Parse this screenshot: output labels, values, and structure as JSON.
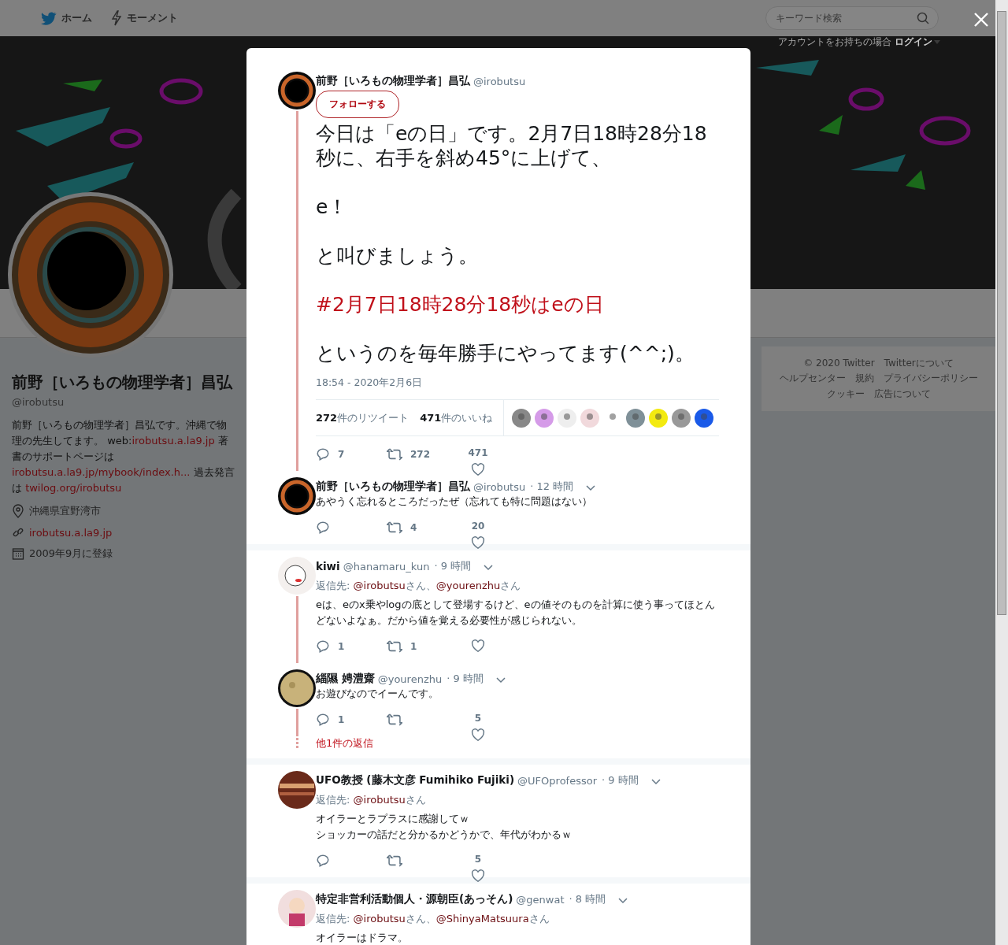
{
  "topnav": {
    "items": [
      {
        "kind": "bird",
        "label": "ホーム"
      },
      {
        "kind": "bolt",
        "label": "モーメント"
      }
    ],
    "search": {
      "placeholder": "キーワード検索"
    },
    "login_prompt": "アカウントをお持ちの場合",
    "login": "ログイン"
  },
  "profile": {
    "name": "前野［いろもの物理学者］昌弘",
    "handle": "@irobutsu",
    "bio": [
      {
        "kind": "text",
        "text": "前野［いろもの物理学者］昌弘です。沖縄で物理の先生してます。 web:"
      },
      {
        "kind": "link",
        "text": "irobutsu.a.la9.jp"
      },
      {
        "kind": "text",
        "text": " 著書のサポートページは "
      },
      {
        "kind": "link",
        "text": "irobutsu.a.la9.jp/mybook/index.h..."
      },
      {
        "kind": "text",
        "text": " 過去発言は "
      },
      {
        "kind": "link",
        "text": "twilog.org/irobutsu"
      }
    ],
    "meta": [
      {
        "kind": "location",
        "text": "沖縄県宜野湾市"
      },
      {
        "kind": "website",
        "text": "irobutsu.a.la9.jp"
      },
      {
        "kind": "joined",
        "text": "2009年9月に登録"
      }
    ]
  },
  "footer_links": [
    "© 2020 Twitter",
    "Twitterについて",
    "ヘルプセンター",
    "規約",
    "プライバシーポリシー",
    "クッキー",
    "広告について"
  ],
  "modal": {
    "tweet": {
      "name": "前野［いろもの物理学者］昌弘",
      "handle": "@irobutsu",
      "follow": "フォローする",
      "paragraphs": [
        {
          "kind": "text",
          "text": "今日は「eの日」です。2月7日18時28分18秒に、右手を斜め45°に上げて、"
        },
        {
          "kind": "text",
          "text": "e！"
        },
        {
          "kind": "text",
          "text": "と叫びましょう。"
        },
        {
          "kind": "hashtag",
          "text": "#2月7日18時28分18秒はeの日"
        },
        {
          "kind": "text",
          "text": "というのを毎年勝手にやってます(^^;)。"
        }
      ],
      "timestamp": "18:54 - 2020年2月6日",
      "retweet_stat": "**272**件のリツイート",
      "like_stat": "**471**件のいいね",
      "replies": "7",
      "retweets": "272",
      "likes": "471"
    },
    "groups": [
      [
        {
          "kind": "swirl",
          "name": "前野［いろもの物理学者］昌弘",
          "handle": "@irobutsu",
          "time": "· 12 時間",
          "lines": [
            "あやうく忘れるところだったぜ（忘れても特に問題はない）"
          ],
          "actions": true,
          "retweets": "4",
          "likes": "20",
          "thread": false
        }
      ],
      [
        {
          "kind": "sketch",
          "name": "kiwi",
          "handle": "@hanamaru_kun",
          "time": "· 9 時間",
          "reply_to": [
            {
              "kind": "text",
              "text": "返信先: "
            },
            {
              "kind": "link",
              "text": "@irobutsu"
            },
            {
              "kind": "text",
              "text": "さん、"
            },
            {
              "kind": "link",
              "text": "@yourenzhu"
            },
            {
              "kind": "text",
              "text": "さん"
            }
          ],
          "lines": [
            "eは、eのx乗やlogの底として登場するけど、eの値そのものを計算に使う事ってほとんどないよなぁ。だから値を覚える必要性が感じられない。"
          ],
          "actions": true,
          "replies": "1",
          "retweets": "1",
          "thread": true
        },
        {
          "kind": "moon",
          "name": "緇隰 娉澧齋",
          "handle": "@yourenzhu",
          "time": "· 9 時間",
          "lines": [
            "お遊びなのでイーんです。"
          ],
          "actions": true,
          "replies": "1",
          "likes": "5",
          "thread": true,
          "more": "他1件の返信"
        }
      ],
      [
        {
          "kind": "planet",
          "name": "UFO教授 (藤木文彦 Fumihiko Fujiki)",
          "handle": "@UFOprofessor",
          "time": "· 9 時間",
          "reply_to": [
            {
              "kind": "text",
              "text": "返信先: "
            },
            {
              "kind": "link",
              "text": "@irobutsu"
            },
            {
              "kind": "text",
              "text": "さん"
            }
          ],
          "lines": [
            "オイラーとラプラスに感謝してｗ",
            "ショッカーの話だと分かるかどうかで、年代がわかるｗ"
          ],
          "actions": true,
          "likes": "5",
          "thread": false
        }
      ],
      [
        {
          "kind": "doll",
          "name": "特定非営利活動個人・源朝臣(あっそん)",
          "handle": "@genwat",
          "time": "· 8 時間",
          "reply_to": [
            {
              "kind": "text",
              "text": "返信先: "
            },
            {
              "kind": "link",
              "text": "@irobutsu"
            },
            {
              "kind": "text",
              "text": "さん、"
            },
            {
              "kind": "link",
              "text": "@ShinyaMatsuura"
            },
            {
              "kind": "text",
              "text": "さん"
            }
          ],
          "lines": [
            "オイラーはドラマ。"
          ],
          "actions": false,
          "thread": false
        }
      ]
    ]
  }
}
